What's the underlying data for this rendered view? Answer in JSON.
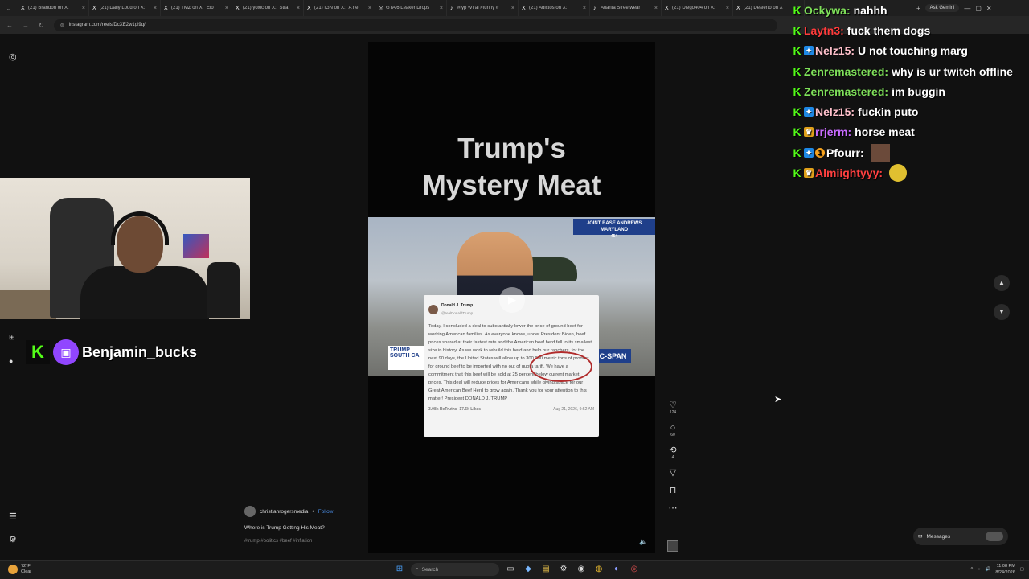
{
  "browser": {
    "tabs": [
      {
        "icon": "X",
        "title": "(21) Brandon on X: \"",
        "close": "×"
      },
      {
        "icon": "X",
        "title": "(21) Daily Loud on X:",
        "close": "×"
      },
      {
        "icon": "X",
        "title": "(21) TMZ on X: \"Elo",
        "close": "×"
      },
      {
        "icon": "X",
        "title": "(21) yoxic on X: \"Stra",
        "close": "×"
      },
      {
        "icon": "X",
        "title": "(21) IGN on X: \"A ne",
        "close": "×"
      },
      {
        "icon": "◎",
        "title": "GTA 6 Leaker Drops",
        "close": "×"
      },
      {
        "icon": "♪",
        "title": "#fyp \\Viral #funny #",
        "close": "×"
      },
      {
        "icon": "X",
        "title": "(21) Adictos on X: \"",
        "close": "×"
      },
      {
        "icon": "♪",
        "title": "Atlanta Streetwear",
        "close": "×"
      },
      {
        "icon": "X",
        "title": "(21) Diego404 on X:",
        "close": "×"
      },
      {
        "icon": "X",
        "title": "(21) Desierto on X",
        "close": "×"
      }
    ],
    "new_tab": "+",
    "ask_gemini": "Ask Gemini",
    "url": "instagram.com/reels/DcXE2w1gl9q/"
  },
  "reel": {
    "title_line1": "Trump's",
    "title_line2": "Mystery Meat",
    "broadcast": {
      "location_line1": "JOINT BASE ANDREWS",
      "location_line2": "MARYLAND",
      "time": "454",
      "lower_third": "TRUMP SOUTH CA",
      "network": "C-SPAN"
    },
    "tweet": {
      "name": "Donald J. Trump",
      "handle": "@realDonaldTrump",
      "text": "Today, I concluded a deal to substantially lower the price of ground beef for working American families. As everyone knows, under President Biden, beef prices soared at their fastest rate and the American beef herd fell to its smallest size in history. As we work to rebuild this herd and help our ranchers, for the next 90 days, the United States will allow up to 300,000 metric tons of product for ground beef to be imported with no out of quota tariff. We have a commitment that this beef will be sold at 25 percent below current market prices. This deal will reduce prices for Americans while giving space for our Great American Beef Herd to grow again. Thank you for your attention to this matter! President DONALD J. TRUMP",
      "retruths": "3.08k ReTruths",
      "likes": "17.6k Likes",
      "date": "Aug 21, 2026, 9:52 AM"
    },
    "actions": {
      "likes": "124",
      "comments": "60",
      "reposts": "4"
    },
    "caption": {
      "user": "christianrogersmedia",
      "separator": "•",
      "follow": "Follow",
      "text": "Where is Trump Getting His Meat?",
      "tags": "#trump #politics #beef #inflation"
    }
  },
  "messages_label": "Messages",
  "streamer": {
    "name": "Benjamin_bucks"
  },
  "chat": [
    {
      "user": "Ockywa",
      "color": "#7fe05a",
      "text": "nahhh",
      "badges": [
        "kick"
      ]
    },
    {
      "user": "Laytn3",
      "color": "#ff3b3b",
      "text": "fuck them dogs",
      "badges": [
        "kick"
      ]
    },
    {
      "user": "Nelz15",
      "color": "#ffc0cb",
      "text": "U not touching marg",
      "badges": [
        "kick",
        "blue"
      ]
    },
    {
      "user": "Zenremastered",
      "color": "#7fe05a",
      "text": "why is ur twitch offline",
      "badges": [
        "kick"
      ]
    },
    {
      "user": "Zenremastered",
      "color": "#7fe05a",
      "text": "im buggin",
      "badges": [
        "kick"
      ]
    },
    {
      "user": "Nelz15",
      "color": "#ffc0cb",
      "text": "fuckin puto",
      "badges": [
        "kick",
        "blue"
      ]
    },
    {
      "user": "rrjerm",
      "color": "#c86bff",
      "text": "horse meat",
      "badges": [
        "kick",
        "gold"
      ]
    },
    {
      "user": "Pfourr",
      "color": "#ffffff",
      "text": "",
      "badges": [
        "kick",
        "blue",
        "sub"
      ],
      "emote": "face"
    },
    {
      "user": "Almiightyyy",
      "color": "#ff4040",
      "text": "",
      "badges": [
        "kick",
        "gold"
      ],
      "emote": "round"
    }
  ],
  "taskbar": {
    "weather_temp": "72°F",
    "weather_desc": "Clear",
    "search": "Search",
    "time": "11:08 PM",
    "date": "8/24/2026"
  }
}
